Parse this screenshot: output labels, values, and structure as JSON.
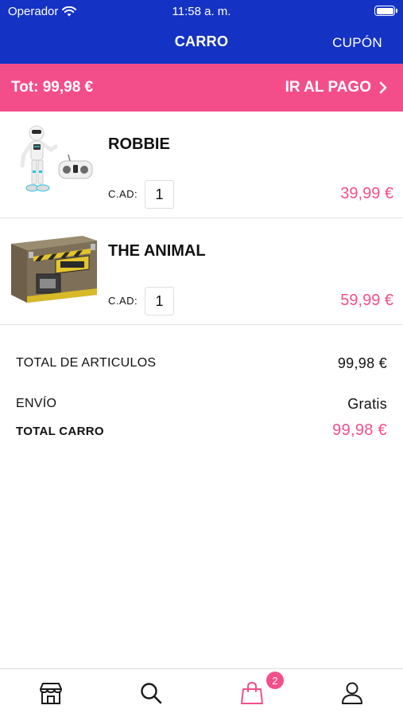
{
  "status_bar": {
    "carrier": "Operador",
    "time": "11:58 a. m."
  },
  "nav": {
    "title": "CARRO",
    "coupon_label": "CUPÓN"
  },
  "total_bar": {
    "total_text": "Tot: 99,98 €",
    "checkout_label": "IR AL PAGO"
  },
  "items": [
    {
      "name": "ROBBIE",
      "qty_label": "C.AD:",
      "qty": "1",
      "price": "39,99 €"
    },
    {
      "name": "THE ANIMAL",
      "qty_label": "C.AD:",
      "qty": "1",
      "price": "59,99 €"
    }
  ],
  "summary": {
    "articles_label": "TOTAL DE ARTICULOS",
    "articles_value": "99,98 €",
    "shipping_label": "ENVÍO",
    "shipping_value": "Gratis",
    "total_label": "TOTAL CARRO",
    "total_value": "99,98 €"
  },
  "tabs": {
    "cart_badge": "2",
    "icons": [
      "store-icon",
      "search-icon",
      "shopping-bag-icon",
      "user-icon"
    ]
  },
  "colors": {
    "header_blue": "#1433c4",
    "accent_pink": "#f44e8a"
  }
}
